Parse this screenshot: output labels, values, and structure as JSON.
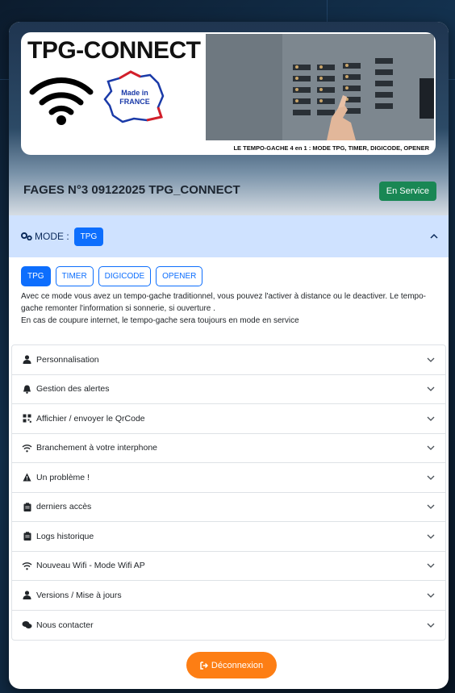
{
  "banner": {
    "brand": "TPG-CONNECT",
    "badge_line1": "Made in",
    "badge_line2": "FRANCE",
    "caption": "LE TEMPO-GACHE 4 en 1 : MODE TPG, TIMER, DIGICODE, OPENER"
  },
  "device": {
    "title": "FAGES N°3 09122025 TPG_CONNECT",
    "status": "En Service",
    "status_color": "#198754"
  },
  "mode": {
    "label": "MODE :",
    "current": "TPG",
    "options": [
      "TPG",
      "TIMER",
      "DIGICODE",
      "OPENER"
    ],
    "desc_line1": "Avec ce mode vous avez un tempo-gache traditionnel, vous pouvez l'activer à distance ou le deactiver. Le tempo-gache remonter l'information si sonnerie, si ouverture .",
    "desc_line2": "En cas de coupure internet, le tempo-gache sera toujours en mode en service"
  },
  "sections": [
    {
      "label": "Personnalisation",
      "icon": "user-icon"
    },
    {
      "label": "Gestion des alertes",
      "icon": "bell-icon"
    },
    {
      "label": "Affichier / envoyer le QrCode",
      "icon": "qrcode-icon"
    },
    {
      "label": "Branchement à votre interphone",
      "icon": "wifi-icon"
    },
    {
      "label": "Un problème !",
      "icon": "warning-icon"
    },
    {
      "label": "derniers accès",
      "icon": "clipboard-icon"
    },
    {
      "label": "Logs historique",
      "icon": "clipboard-icon"
    },
    {
      "label": "Nouveau Wifi - Mode Wifi AP",
      "icon": "wifi-icon"
    },
    {
      "label": "Versions / Mise à jours",
      "icon": "user-icon"
    },
    {
      "label": "Nous contacter",
      "icon": "comments-icon"
    }
  ],
  "logout_label": "Déconnexion",
  "colors": {
    "primary": "#0d6efd",
    "accent": "#fd7e14",
    "mode_header": "#cfe2ff"
  }
}
